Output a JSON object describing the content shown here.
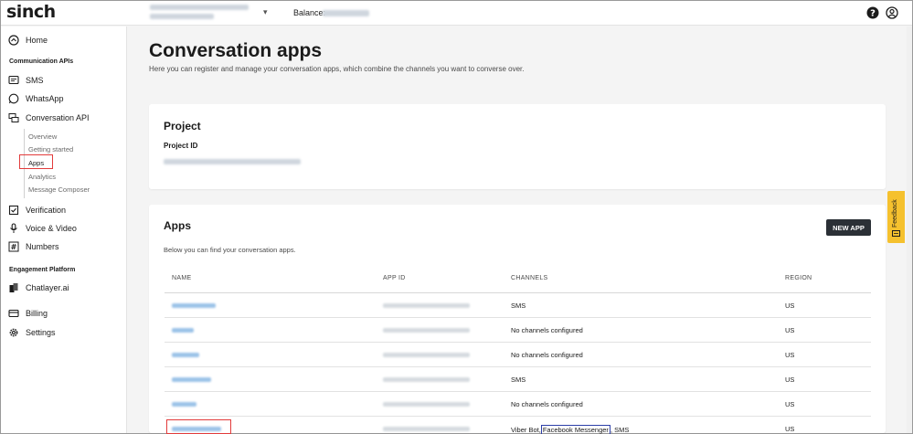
{
  "topbar": {
    "logo": "sinch",
    "balance_label": "Balance:"
  },
  "sidebar": {
    "home": "Home",
    "section_communication": "Communication APIs",
    "sms": "SMS",
    "whatsapp": "WhatsApp",
    "conversation_api": "Conversation API",
    "sub_items": [
      "Overview",
      "Getting started",
      "Apps",
      "Analytics",
      "Message Composer"
    ],
    "verification": "Verification",
    "voice_video": "Voice & Video",
    "numbers": "Numbers",
    "section_engagement": "Engagement Platform",
    "chatlayer": "Chatlayer.ai",
    "billing": "Billing",
    "settings": "Settings"
  },
  "main": {
    "title": "Conversation apps",
    "subtitle": "Here you can register and manage your conversation apps, which combine the channels you want to converse over.",
    "project": {
      "title": "Project",
      "id_label": "Project ID"
    },
    "apps": {
      "title": "Apps",
      "new_app_button": "NEW APP",
      "description": "Below you can find your conversation apps.",
      "columns": [
        "NAME",
        "APP ID",
        "CHANNELS",
        "REGION"
      ],
      "rows": [
        {
          "channels": "SMS",
          "region": "US"
        },
        {
          "channels": "No channels configured",
          "region": "US"
        },
        {
          "channels": "No channels configured",
          "region": "US"
        },
        {
          "channels": "SMS",
          "region": "US"
        },
        {
          "channels": "No channels configured",
          "region": "US"
        },
        {
          "channels_before": "Viber Bot,",
          "channels_highlight": "Facebook Messenger",
          "channels_after": ", SMS",
          "region": "US"
        }
      ]
    }
  },
  "feedback": {
    "label": "Feedback"
  },
  "colors": {
    "highlight_red": "#e23b3b",
    "highlight_blue": "#2c3ea8",
    "button_dark": "#2b3036",
    "feedback_yellow": "#f5c12e"
  }
}
